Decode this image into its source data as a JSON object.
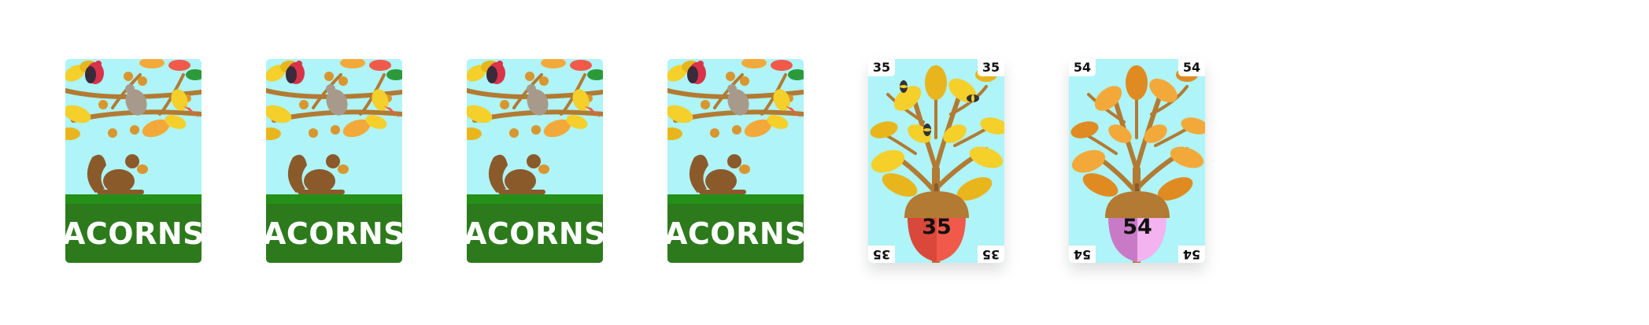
{
  "card_backs": [
    {
      "brand": "ACORNS"
    },
    {
      "brand": "ACORNS"
    },
    {
      "brand": "ACORNS"
    },
    {
      "brand": "ACORNS"
    }
  ],
  "card_faces": [
    {
      "number": "35",
      "acorn_color": "#f15a4a",
      "acorn_shade": "#d9483a",
      "leaf_color": "#f5cf2a",
      "leaf_shade": "#e8b61c"
    },
    {
      "number": "54",
      "acorn_color": "#f3b2f0",
      "acorn_shade": "#c97ac6",
      "leaf_color": "#f3a93a",
      "leaf_shade": "#e08b22"
    }
  ],
  "colors": {
    "sky": "#aef4f8",
    "grass_band": "#2c7a1c",
    "grass_top": "#249018",
    "branch": "#b27a32",
    "squirrel": "#8a5a2b"
  }
}
